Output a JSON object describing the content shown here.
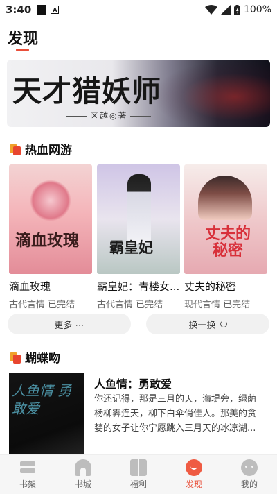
{
  "status_bar": {
    "time": "3:40",
    "battery": "100%",
    "icons": [
      "notification-square-icon",
      "a-app-icon",
      "wifi-icon",
      "signal-icon",
      "battery-icon"
    ]
  },
  "page": {
    "title": "发现"
  },
  "banner": {
    "title": "天才猎妖师",
    "subtitle": "区越◎著"
  },
  "sections": {
    "hot": {
      "title": "热血网游",
      "books": [
        {
          "title": "滴血玫瑰",
          "meta": "古代言情 已完结",
          "cover_text": "滴血玫瑰"
        },
        {
          "title": "霸皇妃：青楼女...",
          "meta": "古代言情 已完结",
          "cover_text": "霸皇妃"
        },
        {
          "title": "丈夫的秘密",
          "meta": "现代言情 已完结",
          "cover_text": "丈夫的秘密"
        }
      ],
      "more_label": "更多 ⋯",
      "refresh_label": "换一换"
    },
    "butterfly": {
      "title": "蝴蝶吻",
      "featured": {
        "title": "人鱼情：勇敢爱",
        "cover_text": "人鱼情 勇敢爱",
        "desc": "你还记得，那是三月的天，海堤旁，绿荫杨柳霁连天，柳下白伞俏佳人。那美的贪婪的女子让你宁愿跳入三月天的冰凉湖..."
      }
    }
  },
  "bottom_nav": {
    "items": [
      {
        "label": "书架",
        "icon": "bookshelf-icon"
      },
      {
        "label": "书城",
        "icon": "bookstore-icon"
      },
      {
        "label": "福利",
        "icon": "gift-icon"
      },
      {
        "label": "发现",
        "icon": "discover-icon",
        "active": true
      },
      {
        "label": "我的",
        "icon": "profile-icon"
      }
    ]
  },
  "colors": {
    "accent": "#e9503b",
    "section_orange": "#f0a12a",
    "section_red": "#e8452f"
  }
}
